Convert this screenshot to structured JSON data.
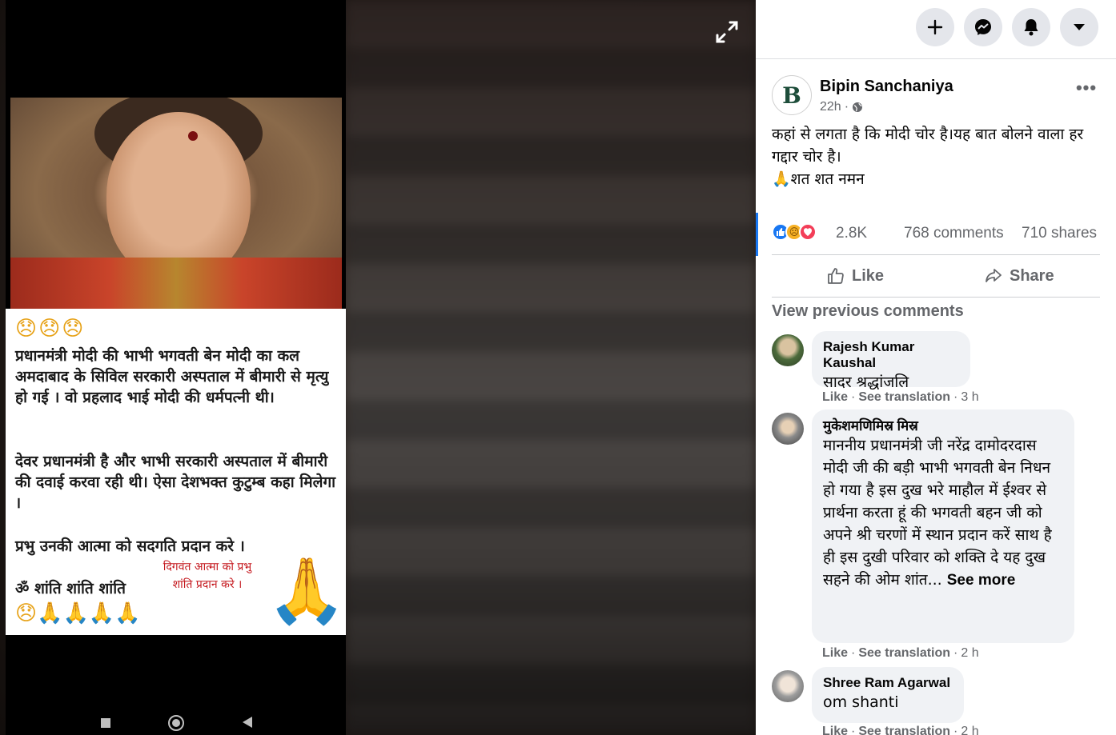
{
  "viewer": {
    "card": {
      "sad_emojis": "😞😞😞",
      "paragraph1": "प्रधानमंत्री मोदी की भाभी भगवती बेन मोदी का कल अमदाबाद के सिविल सरकारी अस्पताल में बीमारी से मृत्यु हो गई । वो प्रहलाद भाई मोदी की धर्मपत्नी थी।",
      "paragraph2": "देवर प्रधानमंत्री है और भाभी सरकारी अस्पताल में बीमारी की दवाई करवा रही थी। ऐसा देशभक्त कुटुम्ब कहा मिलेगा ।",
      "paragraph3": "प्रभु उनकी आत्मा को सदगति प्रदान करे ।",
      "om_line": "ॐ शांति शांति शांति",
      "bottom_emojis": "😞🙏🙏🙏🙏",
      "red_text": "दिगवंत आत्मा को प्रभु शांति प्रदान करे ।",
      "namaste": "🙏"
    }
  },
  "post": {
    "author": "Bipin Sanchaniya",
    "avatar_letter": "B",
    "time": "22h",
    "dot": "·",
    "text_line1": "कहां से लगता है कि मोदी चोर है।यह बात बोलने वाला हर गद्दार चोर है।",
    "text_line2": "🙏शत शत नमन",
    "reaction_count": "2.8K",
    "comments_count": "768 comments",
    "shares_count": "710 shares",
    "like_label": "Like",
    "share_label": "Share",
    "view_previous": "View previous comments"
  },
  "comments": [
    {
      "author": "Rajesh Kumar Kaushal",
      "text": "सादर श्रद्धांजलि",
      "like": "Like",
      "translation": "See translation",
      "time": "3 h"
    },
    {
      "author": "मुकेशमणिमिस्र मिस्र",
      "text": "माननीय प्रधानमंत्री जी नरेंद्र दामोदरदास मोदी जी की बड़ी भाभी भगवती बेन निधन हो गया है इस दुख भरे माहौल में ईश्वर से प्रार्थना करता हूं की भगवती बहन जी को अपने श्री चरणों में स्थान प्रदान करें साथ है ही इस दुखी परिवार को शक्ति दे यह दुख सहने की ओम शांत...",
      "see_more": "See more",
      "like": "Like",
      "translation": "See translation",
      "time": "2 h"
    },
    {
      "author": "Shree Ram Agarwal",
      "text": "om shanti",
      "like": "Like",
      "translation": "See translation",
      "time": "2 h"
    }
  ],
  "colors": {
    "facebook_blue": "#1877f2",
    "secondary_text": "#65676b",
    "bubble_bg": "#f0f2f5"
  },
  "icons": [
    "expand-icon",
    "plus-icon",
    "messenger-icon",
    "bell-icon",
    "caret-down-icon",
    "globe-icon",
    "more-icon",
    "like-outline-icon",
    "share-arrow-icon"
  ]
}
